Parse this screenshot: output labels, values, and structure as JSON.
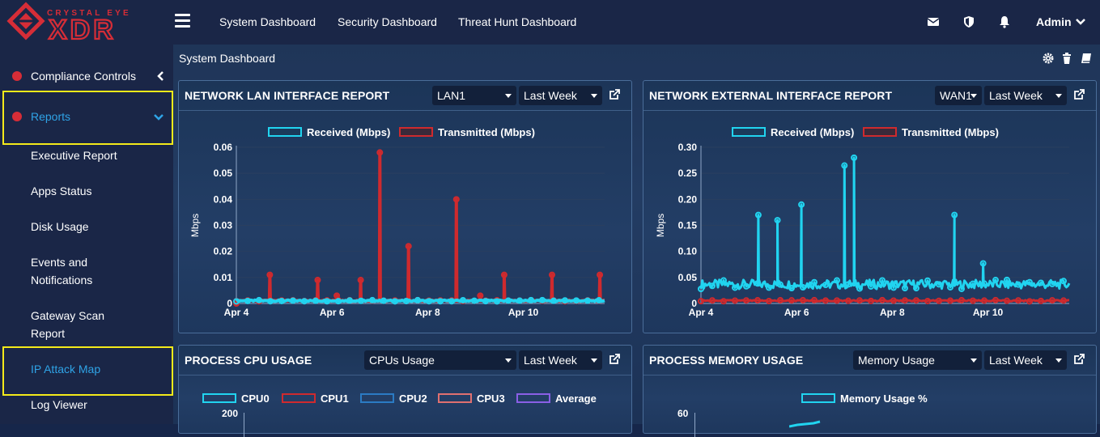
{
  "brand": {
    "tagline": "CRYSTAL EYE",
    "name": "XDR"
  },
  "topnav": [
    {
      "label": "System Dashboard"
    },
    {
      "label": "Security Dashboard"
    },
    {
      "label": "Threat Hunt Dashboard"
    }
  ],
  "user": {
    "label": "Admin"
  },
  "sidebar": {
    "items": [
      {
        "label": "Compliance Controls"
      },
      {
        "label": "Reports"
      },
      {
        "label": "Executive Report"
      },
      {
        "label": "Apps Status"
      },
      {
        "label": "Disk Usage"
      },
      {
        "label": "Events and Notifications"
      },
      {
        "label": "Gateway Scan Report"
      },
      {
        "label": "IP Attack Map"
      },
      {
        "label": "Log Viewer"
      }
    ]
  },
  "page": {
    "title": "System Dashboard"
  },
  "panels": {
    "lan": {
      "title": "NETWORK LAN INTERFACE REPORT",
      "interface": "LAN1",
      "range": "Last Week"
    },
    "wan": {
      "title": "NETWORK EXTERNAL INTERFACE REPORT",
      "interface": "WAN1",
      "range": "Last Week"
    },
    "cpu": {
      "title": "PROCESS CPU USAGE",
      "select": "CPUs Usage",
      "range": "Last Week",
      "legend": [
        "CPU0",
        "CPU1",
        "CPU2",
        "CPU3",
        "Average"
      ],
      "ytop": "200"
    },
    "mem": {
      "title": "PROCESS MEMORY USAGE",
      "select": "Memory Usage",
      "range": "Last Week",
      "legend": [
        "Memory Usage %"
      ],
      "ytop": "60"
    }
  },
  "colors": {
    "received": "#21d4f0",
    "transmitted": "#cf2a2e",
    "accent": "#2fa3e6",
    "highlight": "#f4ea1a",
    "cpu0": "#21d4f0",
    "cpu1": "#cf2a2e",
    "cpu2": "#2b7bc4",
    "cpu3": "#e07070",
    "average": "#8a5fe6"
  },
  "chart_data": [
    {
      "type": "line",
      "title": "NETWORK LAN INTERFACE REPORT",
      "ylabel": "Mbps",
      "yticks": [
        "0",
        "0.01",
        "0.02",
        "0.03",
        "0.04",
        "0.05",
        "0.06"
      ],
      "ylim": [
        0,
        0.06
      ],
      "xticks": [
        "Apr 4",
        "Apr 6",
        "Apr 8",
        "Apr 10"
      ],
      "series": [
        {
          "name": "Received (Mbps)",
          "baseline": 0.001
        },
        {
          "name": "Transmitted (Mbps)",
          "baseline": 0.001,
          "spikes": [
            {
              "x": "Apr 4",
              "y": 0.0
            },
            {
              "x": "Apr 4.7",
              "y": 0.011
            },
            {
              "x": "Apr 5.7",
              "y": 0.009
            },
            {
              "x": "Apr 6.1",
              "y": 0.003
            },
            {
              "x": "Apr 6.6",
              "y": 0.009
            },
            {
              "x": "Apr 7.0",
              "y": 0.058
            },
            {
              "x": "Apr 7.6",
              "y": 0.022
            },
            {
              "x": "Apr 8.6",
              "y": 0.04
            },
            {
              "x": "Apr 9.1",
              "y": 0.003
            },
            {
              "x": "Apr 9.6",
              "y": 0.011
            },
            {
              "x": "Apr 10.6",
              "y": 0.011
            },
            {
              "x": "Apr 11.6",
              "y": 0.011
            }
          ]
        }
      ]
    },
    {
      "type": "line",
      "title": "NETWORK EXTERNAL INTERFACE REPORT",
      "ylabel": "Mbps",
      "yticks": [
        "0",
        "0.05",
        "0.10",
        "0.15",
        "0.20",
        "0.25",
        "0.30"
      ],
      "ylim": [
        0,
        0.3
      ],
      "xticks": [
        "Apr 4",
        "Apr 6",
        "Apr 8",
        "Apr 10"
      ],
      "series": [
        {
          "name": "Received (Mbps)",
          "baseline": 0.035,
          "spikes": [
            {
              "x": "Apr 5.2",
              "y": 0.17
            },
            {
              "x": "Apr 5.6",
              "y": 0.16
            },
            {
              "x": "Apr 6.1",
              "y": 0.19
            },
            {
              "x": "Apr 7.0",
              "y": 0.265
            },
            {
              "x": "Apr 7.2",
              "y": 0.28
            },
            {
              "x": "Apr 9.3",
              "y": 0.17
            },
            {
              "x": "Apr 9.9",
              "y": 0.077
            }
          ]
        },
        {
          "name": "Transmitted (Mbps)",
          "baseline": 0.005
        }
      ]
    },
    {
      "type": "line",
      "title": "PROCESS CPU USAGE",
      "series": [
        {
          "name": "CPU0"
        },
        {
          "name": "CPU1"
        },
        {
          "name": "CPU2"
        },
        {
          "name": "CPU3"
        },
        {
          "name": "Average"
        }
      ]
    },
    {
      "type": "line",
      "title": "PROCESS MEMORY USAGE",
      "series": [
        {
          "name": "Memory Usage %"
        }
      ]
    }
  ]
}
